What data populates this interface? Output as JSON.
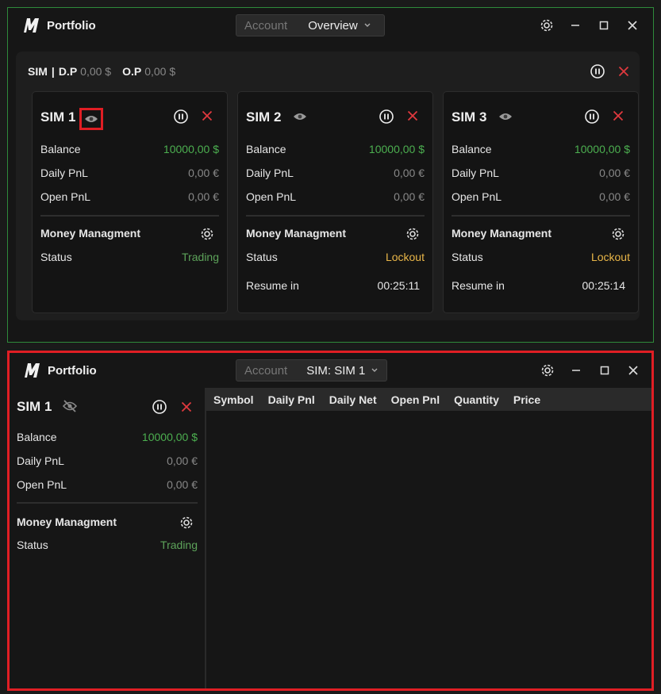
{
  "top_window": {
    "title": "Portfolio",
    "account_label": "Account",
    "account_value": "Overview",
    "group": {
      "name": "SIM",
      "sep": "|",
      "dp_label": "D.P",
      "dp_value": "0,00 $",
      "op_label": "O.P",
      "op_value": "0,00 $"
    },
    "cards": [
      {
        "name": "SIM 1",
        "balance_label": "Balance",
        "balance": "10000,00 $",
        "daily_label": "Daily PnL",
        "daily": "0,00 €",
        "open_label": "Open PnL",
        "open": "0,00 €",
        "mm_label": "Money Managment",
        "status_label": "Status",
        "status": "Trading"
      },
      {
        "name": "SIM 2",
        "balance_label": "Balance",
        "balance": "10000,00 $",
        "daily_label": "Daily PnL",
        "daily": "0,00 €",
        "open_label": "Open PnL",
        "open": "0,00 €",
        "mm_label": "Money Managment",
        "status_label": "Status",
        "status": "Lockout",
        "resume_label": "Resume in",
        "resume": "00:25:11"
      },
      {
        "name": "SIM 3",
        "balance_label": "Balance",
        "balance": "10000,00 $",
        "daily_label": "Daily PnL",
        "daily": "0,00 €",
        "open_label": "Open PnL",
        "open": "0,00 €",
        "mm_label": "Money Managment",
        "status_label": "Status",
        "status": "Lockout",
        "resume_label": "Resume in",
        "resume": "00:25:14"
      }
    ]
  },
  "bottom_window": {
    "title": "Portfolio",
    "account_label": "Account",
    "account_value": "SIM: SIM 1",
    "sim": {
      "name": "SIM 1",
      "balance_label": "Balance",
      "balance": "10000,00 $",
      "daily_label": "Daily PnL",
      "daily": "0,00 €",
      "open_label": "Open PnL",
      "open": "0,00 €",
      "mm_label": "Money Managment",
      "status_label": "Status",
      "status": "Trading"
    },
    "columns": [
      "Symbol",
      "Daily Pnl",
      "Daily Net",
      "Open Pnl",
      "Quantity",
      "Price"
    ]
  },
  "colors": {
    "green_value": "#4caf50",
    "trading": "#5da35a",
    "lockout": "#e9b648",
    "close_red": "#e0393e",
    "highlight_red": "#e01e24",
    "active_border": "#2f8a3b"
  },
  "icons": [
    "logo-icon",
    "chevron-down-icon",
    "gear-icon",
    "minimize-icon",
    "maximize-icon",
    "close-icon",
    "pause-icon",
    "eye-icon",
    "eye-off-icon"
  ]
}
